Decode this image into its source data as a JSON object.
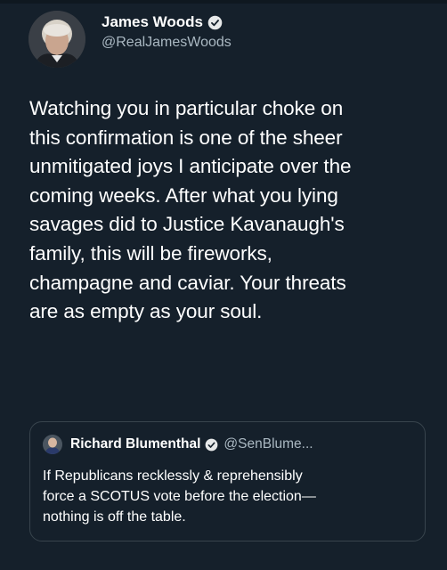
{
  "tweet": {
    "author": {
      "display_name": "James Woods",
      "handle": "@RealJamesWoods"
    },
    "text_lines": [
      "Watching you in particular choke on",
      "this confirmation is one of the sheer",
      "unmitigated joys I anticipate over the",
      "coming weeks. After what you lying",
      "savages did to Justice Kavanaugh's",
      "family, this will be fireworks,",
      "champagne and caviar. Your threats",
      "are as empty as your soul."
    ]
  },
  "quoted_tweet": {
    "author": {
      "display_name": "Richard Blumenthal",
      "handle": "@SenBlume..."
    },
    "text_lines": [
      "If Republicans recklessly & reprehensibly",
      "force a SCOTUS vote before the election—",
      "nothing is off the table."
    ]
  },
  "icons": {
    "verified": "verified-badge-icon"
  },
  "colors": {
    "background": "#15202b",
    "verified": "#1d9bf0",
    "secondary_text": "#aab8c2",
    "quote_border": "#38444d"
  }
}
